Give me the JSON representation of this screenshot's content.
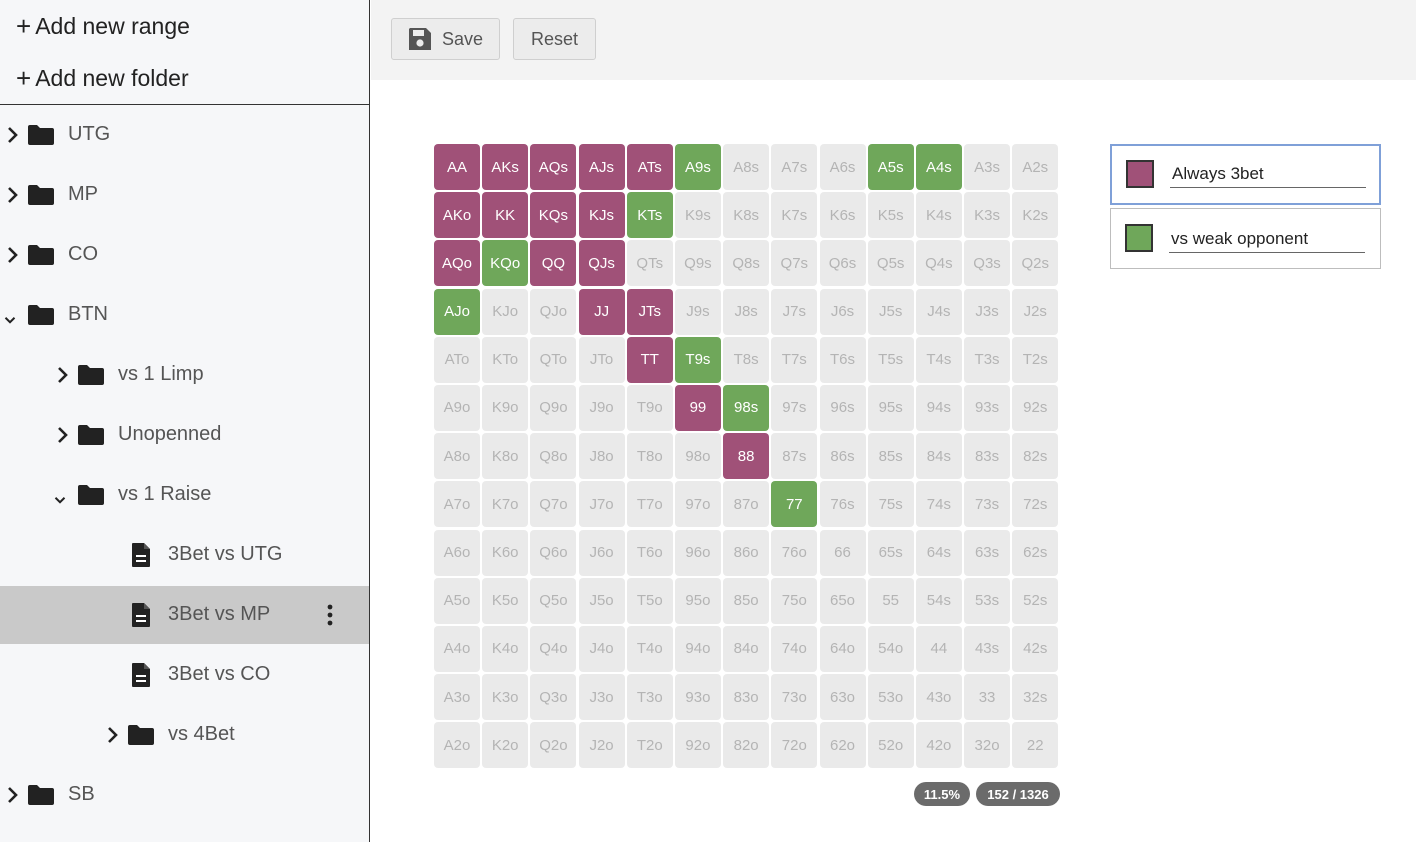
{
  "sidebar": {
    "actions": [
      {
        "label": "Add new range",
        "icon": "plus-icon"
      },
      {
        "label": "Add new folder",
        "icon": "plus-icon"
      }
    ],
    "tree": [
      {
        "label": "UTG",
        "type": "folder",
        "expanded": false,
        "level": 0
      },
      {
        "label": "MP",
        "type": "folder",
        "expanded": false,
        "level": 0
      },
      {
        "label": "CO",
        "type": "folder",
        "expanded": false,
        "level": 0
      },
      {
        "label": "BTN",
        "type": "folder",
        "expanded": true,
        "level": 0
      },
      {
        "label": "vs 1 Limp",
        "type": "folder",
        "expanded": false,
        "level": 1
      },
      {
        "label": "Unopenned",
        "type": "folder",
        "expanded": false,
        "level": 1
      },
      {
        "label": "vs 1 Raise",
        "type": "folder",
        "expanded": true,
        "level": 1
      },
      {
        "label": "3Bet vs UTG",
        "type": "file",
        "level": 2
      },
      {
        "label": "3Bet vs MP",
        "type": "file",
        "level": 2,
        "selected": true
      },
      {
        "label": "3Bet vs CO",
        "type": "file",
        "level": 2
      },
      {
        "label": "vs 4Bet",
        "type": "folder",
        "expanded": false,
        "level": 2
      },
      {
        "label": "SB",
        "type": "folder",
        "expanded": false,
        "level": 0
      }
    ]
  },
  "toolbar": {
    "save_label": "Save",
    "save_icon": "floppy-disk-icon",
    "reset_label": "Reset"
  },
  "ranks": [
    "A",
    "K",
    "Q",
    "J",
    "T",
    "9",
    "8",
    "7",
    "6",
    "5",
    "4",
    "3",
    "2"
  ],
  "actions": [
    {
      "name": "Always 3bet",
      "color": "#a05178",
      "active": true
    },
    {
      "name": "vs weak opponent",
      "color": "#6fa75a",
      "active": false
    }
  ],
  "colors": {
    "unassigned_bg": "#eaeaea",
    "unassigned_text": "#b4b4b4"
  },
  "hands": {
    "always_3bet": [
      "AA",
      "AKs",
      "AQs",
      "AJs",
      "ATs",
      "AKo",
      "KK",
      "KQs",
      "KJs",
      "AQo",
      "QQ",
      "QJs",
      "JJ",
      "JTs",
      "TT",
      "99",
      "88"
    ],
    "vs_weak_opponent": [
      "A9s",
      "A5s",
      "A4s",
      "KTs",
      "KQo",
      "AJo",
      "T9s",
      "98s",
      "77"
    ]
  },
  "stats": {
    "percent": "11.5%",
    "combos": "152 / 1326"
  }
}
